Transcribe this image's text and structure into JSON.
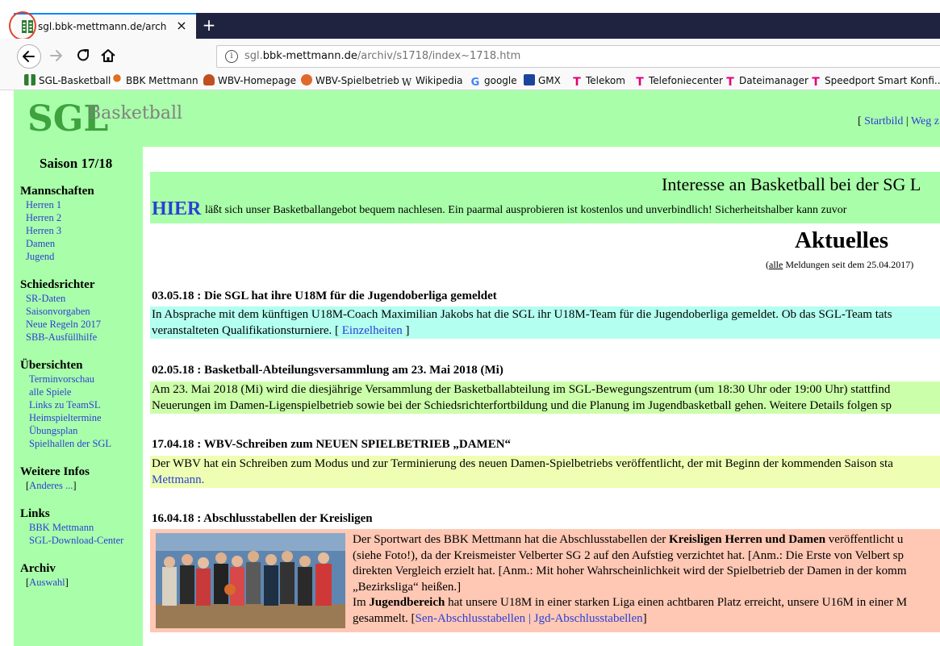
{
  "browser": {
    "tab_title": "sgl.bbk-mettmann.de/archiv/s",
    "close_glyph": "×",
    "new_tab_glyph": "+",
    "url_prefix": "sgl.",
    "url_domain": "bbk-mettmann.de",
    "url_path": "/archiv/s1718/index~1718.htm",
    "info_glyph": "i"
  },
  "bookmarks": [
    {
      "label": "SGL-Basketball",
      "icon": "sgl-favicon",
      "color": "#2e7d32"
    },
    {
      "label": "BBK Mettmann",
      "icon": "bbk-icon",
      "color": "#e07020"
    },
    {
      "label": "WBV-Homepage",
      "icon": "wbv-icon",
      "color": "#c05020"
    },
    {
      "label": "WBV-Spielbetrieb",
      "icon": "basketball-icon",
      "color": "#e06a2a"
    },
    {
      "label": "Wikipedia",
      "icon": "wikipedia-icon",
      "color": "#000000"
    },
    {
      "label": "google",
      "icon": "google-icon",
      "color": "#4285f4"
    },
    {
      "label": "GMX",
      "icon": "gmx-icon",
      "color": "#1c449b"
    },
    {
      "label": "Telekom",
      "icon": "telekom-icon",
      "color": "#e20074"
    },
    {
      "label": "Telefoniecenter",
      "icon": "telekom-icon",
      "color": "#e20074"
    },
    {
      "label": "Dateimanager",
      "icon": "telekom-icon",
      "color": "#e20074"
    },
    {
      "label": "Speedport Smart Konfi...",
      "icon": "telekom-icon",
      "color": "#e20074"
    }
  ],
  "site": {
    "logo_main": "SGL",
    "logo_sub": "Basketball",
    "top_links": {
      "open": "[ ",
      "startbild": "Startbild",
      "sep": " | ",
      "weg": "Weg z"
    }
  },
  "sidebar": {
    "season": "Saison 17/18",
    "sections": [
      {
        "heading": "Mannschaften",
        "items": [
          "Herren 1",
          "Herren 2",
          "Herren 3",
          "Damen",
          "Jugend"
        ]
      },
      {
        "heading": "Schiedsrichter",
        "items": [
          "SR-Daten",
          "Saisonvorgaben",
          "Neue Regeln 2017",
          "SBB-Ausfüllhilfe"
        ]
      },
      {
        "heading": "Übersichten",
        "items": [
          "Terminvorschau",
          "alle Spiele",
          "Links zu TeamSL",
          "Heimspieltermine",
          "Übungsplan",
          "Spielhallen der SGL"
        ]
      },
      {
        "heading": "Weitere Infos",
        "items": [
          "Anderes ..."
        ]
      },
      {
        "heading": "Links",
        "items": [
          "BBK Mettmann",
          "SGL-Download-Center"
        ]
      },
      {
        "heading": "Archiv",
        "items": [
          "Auswahl"
        ]
      }
    ]
  },
  "content": {
    "interesse_title": "Interesse an Basketball bei der SG L",
    "hier": "HIER",
    "hier_text": "läßt sich unser Basketballangebot bequem nachlesen. Ein paarmal ausprobieren ist kostenlos und unverbindlich! Sicherheitshalber kann zuvor",
    "aktuelles": "Aktuelles",
    "aktuelles_note_open": "(",
    "aktuelles_note_link": "alle",
    "aktuelles_note_rest": " Meldungen seit dem 25.04.2017)",
    "news": [
      {
        "heading": "03.05.18 : Die SGL hat ihre U18M für die Jugendoberliga gemeldet",
        "line1": "In Absprache mit dem künftigen U18M-Coach Maximilian Jakobs hat die SGL ihr U18M-Team für die Jugendoberliga gemeldet. Ob das SGL-Team tats",
        "line2_pre": "veranstalteten Qualifikationsturniere. [ ",
        "line2_link": "Einzelheiten",
        "line2_post": " ]"
      },
      {
        "heading": "02.05.18 : Basketball-Abteilungsversammlung am 23. Mai 2018 (Mi)",
        "line1": "Am 23. Mai 2018 (Mi) wird die diesjährige Versammlung der Basketballabteilung im SGL-Bewegungszentrum (um 18:30 Uhr oder 19:00 Uhr) stattfind",
        "line2": "Neuerungen im Damen-Ligenspielbetrieb sowie bei der Schiedsrichterfortbildung und die Planung im Jugendbasketball gehen. Weitere Details folgen sp"
      },
      {
        "heading": "17.04.18 : WBV-Schreiben zum NEUEN SPIELBETRIEB „DAMEN“",
        "line1": "Der WBV hat ein Schreiben zum Modus und zur Terminierung des neuen Damen-Spielbetriebs veröffentlicht, der mit Beginn der kommenden Saison sta",
        "line2_link": "Mettmann."
      },
      {
        "heading": "16.04.18 : Abschlusstabellen der Kreisligen",
        "l1_pre": "Der Sportwart des BBK Mettmann hat die Abschlusstabellen der ",
        "l1_bold": "Kreisligen Herren und Damen",
        "l1_post": " veröffentlicht u",
        "l2": "(siehe Foto!), da der Kreismeister Velberter SG 2 auf den Aufstieg verzichtet hat. [Anm.: Die Erste von Velbert sp",
        "l3": "direkten Vergleich erzielt hat. [Anm.: Mit hoher Wahrscheinlichkeit wird der Spielbetrieb der Damen in der komm",
        "l4": "„Bezirksliga“ heißen.]",
        "l5_pre": "Im ",
        "l5_bold": "Jugendbereich",
        "l5_post": " hat unsere U18M in einer starken Liga einen achtbaren Platz erreicht, unsere U16M in einer M",
        "l6_pre": "gesammelt. [",
        "l6_link1": "Sen-Abschlusstabellen",
        "l6_sep": " | ",
        "l6_link2": "Jgd-Abschlusstabellen",
        "l6_post": "]"
      }
    ]
  },
  "colors": {
    "page_green": "#a9ffa9",
    "link_blue": "#2a3fd6",
    "logo_green": "#3ea23e",
    "news1_bg": "#b3fff0",
    "news2_bg": "#ccffaa",
    "news3_bg": "#eeffb3",
    "news4_bg": "#ffc8b4"
  }
}
